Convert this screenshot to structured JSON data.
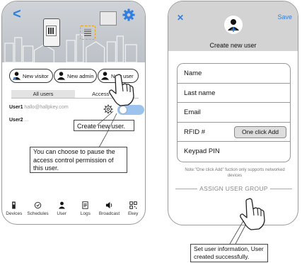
{
  "screen1": {
    "visitor_label": "New visitor",
    "admin_label": "New admin",
    "user_label": "New user",
    "tabs": [
      {
        "label": "All users",
        "active": true
      },
      {
        "label": "Access level",
        "active": false
      }
    ],
    "users": [
      {
        "name": "User1",
        "email": "hallo@hallpkey.com"
      },
      {
        "name": "User2",
        "email": "..."
      }
    ],
    "callout_new_user": "Create new user.",
    "callout_pause": "You can choose to pause the access control permission of this user.",
    "nav": [
      {
        "label": "Devices"
      },
      {
        "label": "Schedules"
      },
      {
        "label": "User"
      },
      {
        "label": "Logs"
      },
      {
        "label": "Broadcast"
      },
      {
        "label": "Ekey"
      }
    ],
    "accent": "#2f7fe0"
  },
  "screen2": {
    "close_label": "✕",
    "save_label": "Save",
    "title": "Create new user",
    "fields": [
      {
        "label": "Name"
      },
      {
        "label": "Last name"
      },
      {
        "label": "Email"
      },
      {
        "label": "RFID #"
      },
      {
        "label": "Keypad PIN"
      }
    ],
    "one_click_add": "One click Add",
    "note": "Note:\"One click Add\" fuction only supports networked devices",
    "assign_group": "ASSIGN USER GROUP",
    "callout_info": "Set user information, User created successfully."
  }
}
